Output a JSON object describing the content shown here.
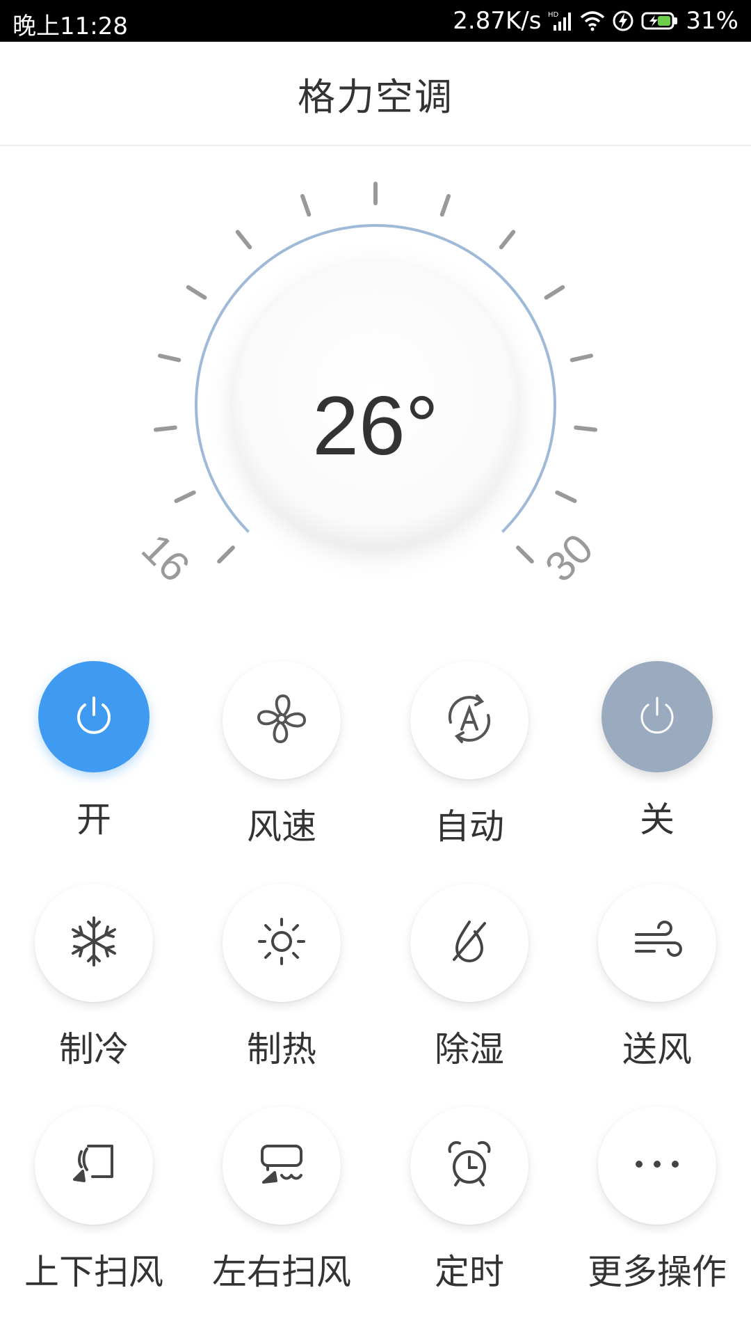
{
  "status_bar": {
    "time": "晚上11:28",
    "net_speed": "2.87K/s",
    "battery_percent": "31%",
    "icons": [
      "hd-signal-icon",
      "wifi-icon",
      "charging-icon",
      "battery-icon"
    ]
  },
  "header": {
    "title": "格力空调"
  },
  "dial": {
    "temperature": "26°",
    "scale_min": "16",
    "scale_max": "30",
    "accent_color": "#9fb9d8"
  },
  "buttons": {
    "row1": [
      {
        "label": "开",
        "icon": "power-icon",
        "style": "on",
        "color": "#3f9bf2"
      },
      {
        "label": "风速",
        "icon": "fan-icon"
      },
      {
        "label": "自动",
        "icon": "auto-mode-icon"
      },
      {
        "label": "关",
        "icon": "power-icon",
        "style": "off",
        "color": "#9aabbf"
      }
    ],
    "row2": [
      {
        "label": "制冷",
        "icon": "snowflake-icon"
      },
      {
        "label": "制热",
        "icon": "sun-icon"
      },
      {
        "label": "除湿",
        "icon": "dehumidify-icon"
      },
      {
        "label": "送风",
        "icon": "wind-icon"
      }
    ],
    "row3": [
      {
        "label": "上下扫风",
        "icon": "vertical-swing-icon"
      },
      {
        "label": "左右扫风",
        "icon": "horizontal-swing-icon"
      },
      {
        "label": "定时",
        "icon": "alarm-clock-icon"
      },
      {
        "label": "更多操作",
        "icon": "more-icon"
      }
    ]
  }
}
